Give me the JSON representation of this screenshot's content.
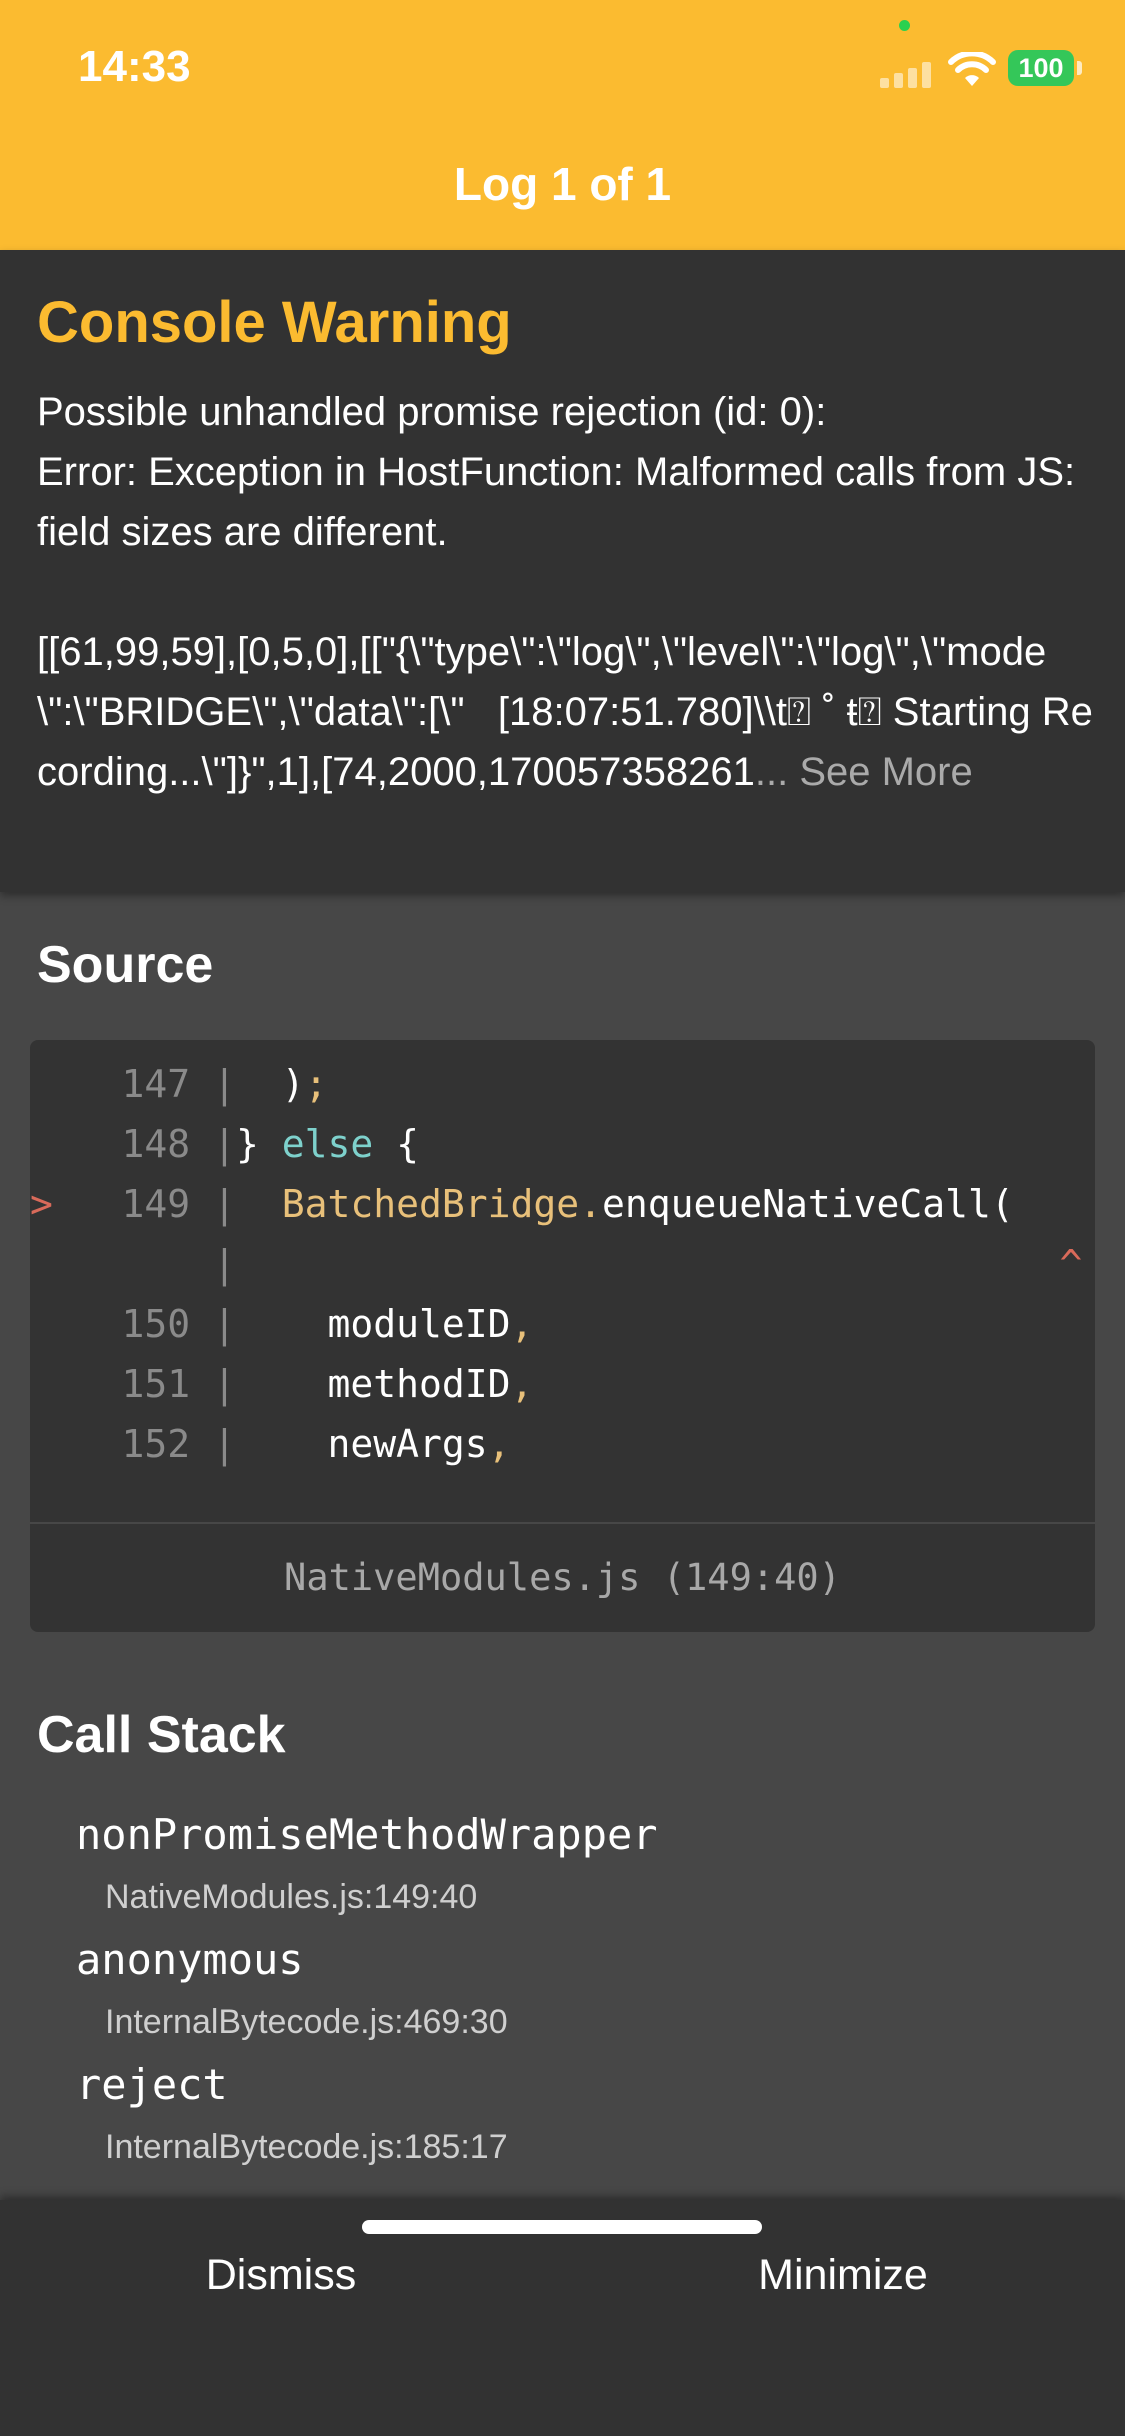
{
  "status_bar": {
    "time": "14:33",
    "battery": "100"
  },
  "header": {
    "title": "Log 1 of 1"
  },
  "message": {
    "title": "Console Warning",
    "body": "Possible unhandled promise rejection (id: 0):\nError: Exception in HostFunction: Malformed calls from JS: field sizes are different.\n\n[[61,99,59],[0,5,0],[[\"{\\\"type\\\":\\\"log\\\",\\\"level\\\":\\\"log\\\",\\\"mode\\\":\\\"BRIDGE\\\",\\\"data\\\":[\\\"   [18:07:51.780]\\\\t⍰ ˚ ŧ⍰ Starting Recording...\\\"]}\",1],[74,2000,170057358261",
    "see_more": "... See More"
  },
  "source": {
    "title": "Source",
    "lines": [
      {
        "marker": " ",
        "num": "147",
        "sep": "|",
        "code": "  );"
      },
      {
        "marker": " ",
        "num": "148",
        "sep": "|",
        "code": "} else {"
      },
      {
        "marker": ">",
        "num": "149",
        "sep": "|",
        "code": "  BatchedBridge.enqueueNativeCall("
      },
      {
        "marker": " ",
        "num": "",
        "sep": "|",
        "code": "                                    ^"
      },
      {
        "marker": " ",
        "num": "150",
        "sep": "|",
        "code": "    moduleID,"
      },
      {
        "marker": " ",
        "num": "151",
        "sep": "|",
        "code": "    methodID,"
      },
      {
        "marker": " ",
        "num": "152",
        "sep": "|",
        "code": "    newArgs,"
      }
    ],
    "file": "NativeModules.js (149:40)"
  },
  "call_stack": {
    "title": "Call Stack",
    "frames": [
      {
        "method": "nonPromiseMethodWrapper",
        "location": "NativeModules.js:149:40"
      },
      {
        "method": "anonymous",
        "location": "InternalBytecode.js:469:30"
      },
      {
        "method": "reject",
        "location": "InternalBytecode.js:185:17"
      }
    ]
  },
  "bottom_bar": {
    "dismiss_label": "Dismiss",
    "minimize_label": "Minimize"
  }
}
